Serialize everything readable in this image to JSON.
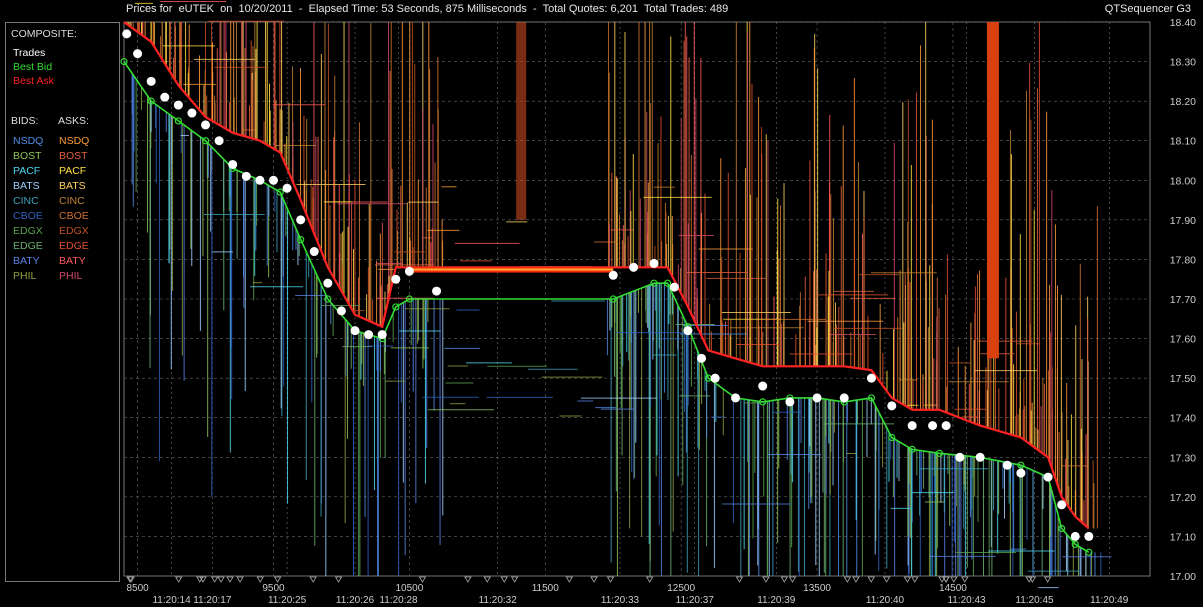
{
  "header": {
    "title_text": "Prices for  eUTEK  on  10/20/2011  -  Elapsed Time: 53 Seconds, 875 Milliseconds  -  Total Quotes: 6,201  Total Trades: 489",
    "app_name": "QTSequencer G3"
  },
  "legend": {
    "composite_heading": "COMPOSITE:",
    "composite": [
      {
        "label": "Trades",
        "color": "#ffffff"
      },
      {
        "label": "Best Bid",
        "color": "#33dd33"
      },
      {
        "label": "Best Ask",
        "color": "#ff2222"
      }
    ],
    "bids_heading": "BIDS:",
    "asks_heading": "ASKS:",
    "bids": [
      {
        "label": "NSDQ",
        "color": "#4f8fe8"
      },
      {
        "label": "BOST",
        "color": "#8cc25a"
      },
      {
        "label": "PACF",
        "color": "#4fd8f0"
      },
      {
        "label": "BATS",
        "color": "#9fd0ff"
      },
      {
        "label": "CINC",
        "color": "#3fa0b8"
      },
      {
        "label": "CBOE",
        "color": "#3060c0"
      },
      {
        "label": "EDGX",
        "color": "#5aa050"
      },
      {
        "label": "EDGE",
        "color": "#6cb070"
      },
      {
        "label": "BATY",
        "color": "#5a80e0"
      },
      {
        "label": "PHIL",
        "color": "#8ca040"
      }
    ],
    "asks": [
      {
        "label": "NSDQ",
        "color": "#ff9a3a"
      },
      {
        "label": "BOST",
        "color": "#e06040"
      },
      {
        "label": "PACF",
        "color": "#ffe040"
      },
      {
        "label": "BATS",
        "color": "#ffd060"
      },
      {
        "label": "CINC",
        "color": "#c08030"
      },
      {
        "label": "CBOE",
        "color": "#d07030"
      },
      {
        "label": "EDGX",
        "color": "#c05020"
      },
      {
        "label": "EDGE",
        "color": "#e05030"
      },
      {
        "label": "BATY",
        "color": "#ff5a5a"
      },
      {
        "label": "PHIL",
        "color": "#d04a6a"
      }
    ]
  },
  "chart_data": {
    "type": "line",
    "ylim": [
      17.0,
      18.4
    ],
    "xlim": [
      8400,
      15950
    ],
    "y_ticks": [
      "17.00",
      "17.10",
      "17.20",
      "17.30",
      "17.40",
      "17.50",
      "17.60",
      "17.70",
      "17.80",
      "17.90",
      "18.00",
      "18.10",
      "18.20",
      "18.30",
      "18.40"
    ],
    "x_ticks_seq": [
      8500,
      9500,
      10500,
      11500,
      12500,
      13500,
      14500
    ],
    "x_ticks_time": [
      {
        "x": 8750,
        "label": "11:20:14"
      },
      {
        "x": 9050,
        "label": "11:20:17"
      },
      {
        "x": 9600,
        "label": "11:20:25"
      },
      {
        "x": 10100,
        "label": "11:20:26"
      },
      {
        "x": 10420,
        "label": "11:20:28"
      },
      {
        "x": 11150,
        "label": "11:20:32"
      },
      {
        "x": 12050,
        "label": "11:20:33"
      },
      {
        "x": 12600,
        "label": "11:20:37"
      },
      {
        "x": 13200,
        "label": "11:20:39"
      },
      {
        "x": 14000,
        "label": "11:20:40"
      },
      {
        "x": 14600,
        "label": "11:20:43"
      },
      {
        "x": 15100,
        "label": "11:20:45"
      },
      {
        "x": 15650,
        "label": "11:20:49"
      }
    ],
    "grid": true,
    "legend_position": "left",
    "series": [
      {
        "name": "Best Ask",
        "color": "#ff2222",
        "points": [
          [
            8400,
            18.4
          ],
          [
            8600,
            18.35
          ],
          [
            8800,
            18.24
          ],
          [
            9000,
            18.16
          ],
          [
            9200,
            18.12
          ],
          [
            9400,
            18.1
          ],
          [
            9550,
            18.07
          ],
          [
            9700,
            17.95
          ],
          [
            9900,
            17.78
          ],
          [
            10100,
            17.66
          ],
          [
            10300,
            17.63
          ],
          [
            10400,
            17.78
          ],
          [
            10500,
            17.78
          ],
          [
            12000,
            17.78
          ],
          [
            12300,
            17.78
          ],
          [
            12400,
            17.78
          ],
          [
            12550,
            17.68
          ],
          [
            12700,
            17.57
          ],
          [
            12900,
            17.55
          ],
          [
            13100,
            17.53
          ],
          [
            13300,
            17.53
          ],
          [
            13500,
            17.53
          ],
          [
            13700,
            17.53
          ],
          [
            13900,
            17.52
          ],
          [
            14050,
            17.45
          ],
          [
            14200,
            17.42
          ],
          [
            14400,
            17.42
          ],
          [
            14700,
            17.38
          ],
          [
            15000,
            17.35
          ],
          [
            15200,
            17.3
          ],
          [
            15300,
            17.2
          ],
          [
            15400,
            17.15
          ],
          [
            15500,
            17.12
          ]
        ]
      },
      {
        "name": "Best Bid",
        "color": "#33dd33",
        "points": [
          [
            8400,
            18.3
          ],
          [
            8600,
            18.2
          ],
          [
            8800,
            18.15
          ],
          [
            9000,
            18.1
          ],
          [
            9200,
            18.03
          ],
          [
            9400,
            18.0
          ],
          [
            9550,
            17.97
          ],
          [
            9700,
            17.85
          ],
          [
            9900,
            17.7
          ],
          [
            10100,
            17.62
          ],
          [
            10300,
            17.6
          ],
          [
            10400,
            17.68
          ],
          [
            10500,
            17.7
          ],
          [
            12000,
            17.7
          ],
          [
            12300,
            17.74
          ],
          [
            12400,
            17.74
          ],
          [
            12550,
            17.63
          ],
          [
            12700,
            17.5
          ],
          [
            12900,
            17.45
          ],
          [
            13100,
            17.44
          ],
          [
            13300,
            17.45
          ],
          [
            13500,
            17.45
          ],
          [
            13700,
            17.44
          ],
          [
            13900,
            17.45
          ],
          [
            14050,
            17.35
          ],
          [
            14200,
            17.32
          ],
          [
            14400,
            17.31
          ],
          [
            14700,
            17.3
          ],
          [
            15000,
            17.28
          ],
          [
            15200,
            17.25
          ],
          [
            15300,
            17.12
          ],
          [
            15400,
            17.08
          ],
          [
            15500,
            17.06
          ]
        ]
      },
      {
        "name": "Trades",
        "color": "#ffffff",
        "points": [
          [
            8420,
            18.37
          ],
          [
            8500,
            18.32
          ],
          [
            8600,
            18.25
          ],
          [
            8700,
            18.21
          ],
          [
            8800,
            18.19
          ],
          [
            8900,
            18.17
          ],
          [
            9000,
            18.14
          ],
          [
            9100,
            18.1
          ],
          [
            9200,
            18.04
          ],
          [
            9300,
            18.01
          ],
          [
            9400,
            18.0
          ],
          [
            9500,
            18.0
          ],
          [
            9600,
            17.98
          ],
          [
            9700,
            17.9
          ],
          [
            9800,
            17.82
          ],
          [
            9900,
            17.74
          ],
          [
            10000,
            17.67
          ],
          [
            10100,
            17.62
          ],
          [
            10200,
            17.61
          ],
          [
            10300,
            17.61
          ],
          [
            10400,
            17.75
          ],
          [
            10500,
            17.77
          ],
          [
            10700,
            17.72
          ],
          [
            12000,
            17.76
          ],
          [
            12150,
            17.78
          ],
          [
            12300,
            17.79
          ],
          [
            12450,
            17.73
          ],
          [
            12550,
            17.62
          ],
          [
            12650,
            17.55
          ],
          [
            12750,
            17.5
          ],
          [
            12900,
            17.45
          ],
          [
            13100,
            17.48
          ],
          [
            13300,
            17.44
          ],
          [
            13500,
            17.45
          ],
          [
            13700,
            17.45
          ],
          [
            13900,
            17.5
          ],
          [
            14050,
            17.43
          ],
          [
            14200,
            17.38
          ],
          [
            14350,
            17.38
          ],
          [
            14450,
            17.38
          ],
          [
            14550,
            17.3
          ],
          [
            14700,
            17.3
          ],
          [
            14900,
            17.28
          ],
          [
            15000,
            17.26
          ],
          [
            15200,
            17.25
          ],
          [
            15300,
            17.18
          ],
          [
            15400,
            17.1
          ],
          [
            15500,
            17.1
          ]
        ]
      }
    ]
  }
}
